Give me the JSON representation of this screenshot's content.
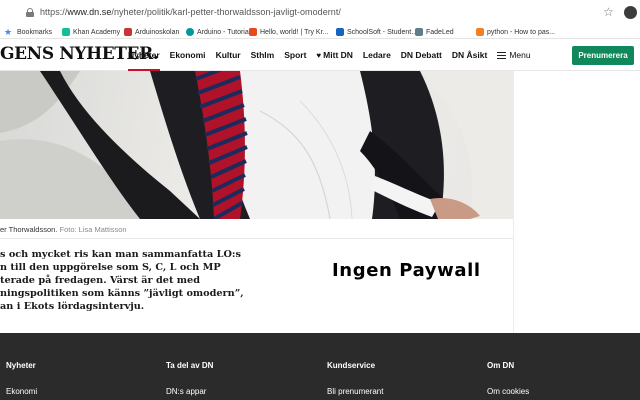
{
  "browser": {
    "url_scheme": "https://",
    "url_host": "www.dn.se",
    "url_path": "/nyheter/politik/karl-petter-thorwaldsson-javligt-omodernt/",
    "bookmarks": [
      {
        "label": "Bookmarks",
        "color": "#4285f4"
      },
      {
        "label": "Khan Academy",
        "color": "#14bf96"
      },
      {
        "label": "Arduinoskolan",
        "color": "#cc3333"
      },
      {
        "label": "Arduino - Tutorials",
        "color": "#00979d"
      },
      {
        "label": "Hello, world! | Try Kr...",
        "color": "#e64a19"
      },
      {
        "label": "SchoolSoft - Student...",
        "color": "#1565c0"
      },
      {
        "label": "FadeLed",
        "color": "#607d8b"
      },
      {
        "label": "python - How to pas...",
        "color": "#f48024"
      }
    ]
  },
  "site": {
    "logo": "GENS NYHETER.",
    "nav": [
      "Nyheter",
      "Ekonomi",
      "Kultur",
      "Sthlm",
      "Sport",
      "Mitt DN",
      "Ledare",
      "DN Debatt",
      "DN Åsikt"
    ],
    "menu_label": "Menu",
    "subscribe_label": "Prenumerera",
    "accent_color": "#c8102e",
    "subscribe_color": "#10885c"
  },
  "article": {
    "caption_name": "er Thorwaldsson.",
    "caption_photo": "Foto: Lisa Mattisson",
    "lead_lines": [
      "s och mycket ris kan man sammanfatta LO:s",
      "n till den uppgörelse som S, C, L och MP",
      "terade på fredagen. Värst är det med",
      "ningspolitiken som känns ”jävligt omodern”,",
      "an i Ekots lördagsintervju."
    ]
  },
  "overlay_text": "Ingen Paywall",
  "footer": {
    "columns": [
      {
        "heading": "Nyheter",
        "link": "Ekonomi"
      },
      {
        "heading": "Ta del av DN",
        "link": "DN:s appar"
      },
      {
        "heading": "Kundservice",
        "link": "Bli prenumerant"
      },
      {
        "heading": "Om DN",
        "link": "Om cookies"
      }
    ]
  }
}
